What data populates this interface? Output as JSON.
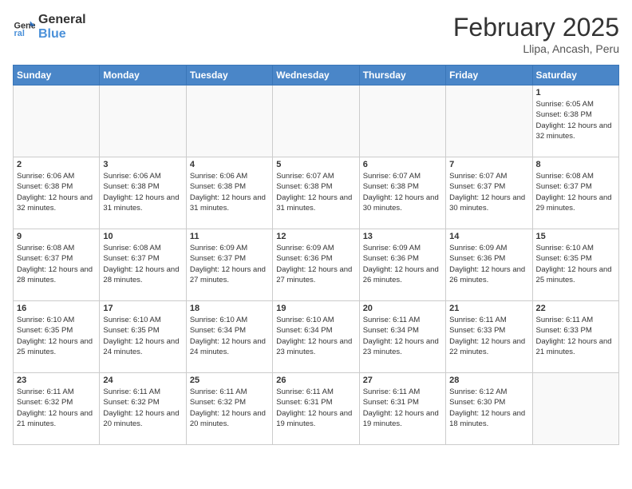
{
  "logo": {
    "line1": "General",
    "line2": "Blue"
  },
  "title": "February 2025",
  "subtitle": "Llipa, Ancash, Peru",
  "days_of_week": [
    "Sunday",
    "Monday",
    "Tuesday",
    "Wednesday",
    "Thursday",
    "Friday",
    "Saturday"
  ],
  "weeks": [
    [
      {
        "day": "",
        "info": ""
      },
      {
        "day": "",
        "info": ""
      },
      {
        "day": "",
        "info": ""
      },
      {
        "day": "",
        "info": ""
      },
      {
        "day": "",
        "info": ""
      },
      {
        "day": "",
        "info": ""
      },
      {
        "day": "1",
        "info": "Sunrise: 6:05 AM\nSunset: 6:38 PM\nDaylight: 12 hours and 32 minutes."
      }
    ],
    [
      {
        "day": "2",
        "info": "Sunrise: 6:06 AM\nSunset: 6:38 PM\nDaylight: 12 hours and 32 minutes."
      },
      {
        "day": "3",
        "info": "Sunrise: 6:06 AM\nSunset: 6:38 PM\nDaylight: 12 hours and 31 minutes."
      },
      {
        "day": "4",
        "info": "Sunrise: 6:06 AM\nSunset: 6:38 PM\nDaylight: 12 hours and 31 minutes."
      },
      {
        "day": "5",
        "info": "Sunrise: 6:07 AM\nSunset: 6:38 PM\nDaylight: 12 hours and 31 minutes."
      },
      {
        "day": "6",
        "info": "Sunrise: 6:07 AM\nSunset: 6:38 PM\nDaylight: 12 hours and 30 minutes."
      },
      {
        "day": "7",
        "info": "Sunrise: 6:07 AM\nSunset: 6:37 PM\nDaylight: 12 hours and 30 minutes."
      },
      {
        "day": "8",
        "info": "Sunrise: 6:08 AM\nSunset: 6:37 PM\nDaylight: 12 hours and 29 minutes."
      }
    ],
    [
      {
        "day": "9",
        "info": "Sunrise: 6:08 AM\nSunset: 6:37 PM\nDaylight: 12 hours and 28 minutes."
      },
      {
        "day": "10",
        "info": "Sunrise: 6:08 AM\nSunset: 6:37 PM\nDaylight: 12 hours and 28 minutes."
      },
      {
        "day": "11",
        "info": "Sunrise: 6:09 AM\nSunset: 6:37 PM\nDaylight: 12 hours and 27 minutes."
      },
      {
        "day": "12",
        "info": "Sunrise: 6:09 AM\nSunset: 6:36 PM\nDaylight: 12 hours and 27 minutes."
      },
      {
        "day": "13",
        "info": "Sunrise: 6:09 AM\nSunset: 6:36 PM\nDaylight: 12 hours and 26 minutes."
      },
      {
        "day": "14",
        "info": "Sunrise: 6:09 AM\nSunset: 6:36 PM\nDaylight: 12 hours and 26 minutes."
      },
      {
        "day": "15",
        "info": "Sunrise: 6:10 AM\nSunset: 6:35 PM\nDaylight: 12 hours and 25 minutes."
      }
    ],
    [
      {
        "day": "16",
        "info": "Sunrise: 6:10 AM\nSunset: 6:35 PM\nDaylight: 12 hours and 25 minutes."
      },
      {
        "day": "17",
        "info": "Sunrise: 6:10 AM\nSunset: 6:35 PM\nDaylight: 12 hours and 24 minutes."
      },
      {
        "day": "18",
        "info": "Sunrise: 6:10 AM\nSunset: 6:34 PM\nDaylight: 12 hours and 24 minutes."
      },
      {
        "day": "19",
        "info": "Sunrise: 6:10 AM\nSunset: 6:34 PM\nDaylight: 12 hours and 23 minutes."
      },
      {
        "day": "20",
        "info": "Sunrise: 6:11 AM\nSunset: 6:34 PM\nDaylight: 12 hours and 23 minutes."
      },
      {
        "day": "21",
        "info": "Sunrise: 6:11 AM\nSunset: 6:33 PM\nDaylight: 12 hours and 22 minutes."
      },
      {
        "day": "22",
        "info": "Sunrise: 6:11 AM\nSunset: 6:33 PM\nDaylight: 12 hours and 21 minutes."
      }
    ],
    [
      {
        "day": "23",
        "info": "Sunrise: 6:11 AM\nSunset: 6:32 PM\nDaylight: 12 hours and 21 minutes."
      },
      {
        "day": "24",
        "info": "Sunrise: 6:11 AM\nSunset: 6:32 PM\nDaylight: 12 hours and 20 minutes."
      },
      {
        "day": "25",
        "info": "Sunrise: 6:11 AM\nSunset: 6:32 PM\nDaylight: 12 hours and 20 minutes."
      },
      {
        "day": "26",
        "info": "Sunrise: 6:11 AM\nSunset: 6:31 PM\nDaylight: 12 hours and 19 minutes."
      },
      {
        "day": "27",
        "info": "Sunrise: 6:11 AM\nSunset: 6:31 PM\nDaylight: 12 hours and 19 minutes."
      },
      {
        "day": "28",
        "info": "Sunrise: 6:12 AM\nSunset: 6:30 PM\nDaylight: 12 hours and 18 minutes."
      },
      {
        "day": "",
        "info": ""
      }
    ]
  ]
}
